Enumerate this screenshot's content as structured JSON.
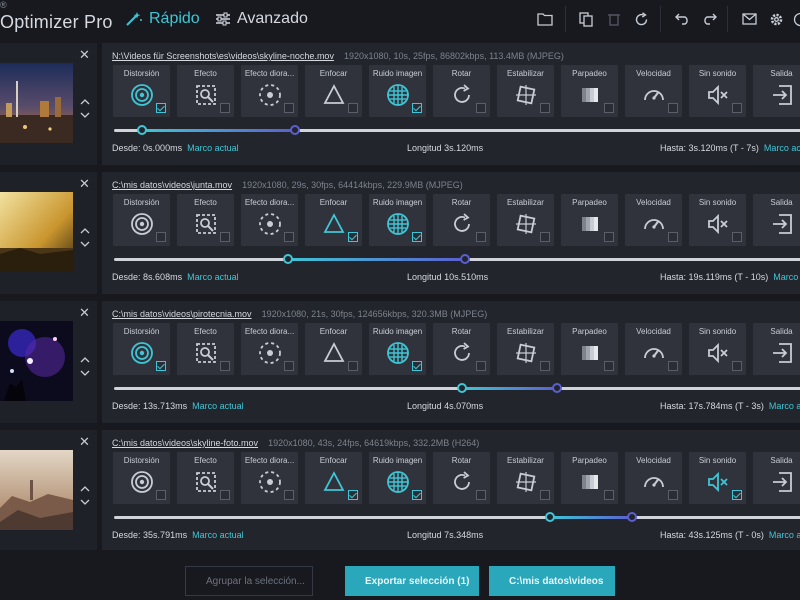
{
  "app": {
    "logo_sup": "®",
    "name": "Optimizer Pro"
  },
  "modes": {
    "quick": "Rápido",
    "advanced": "Avanzado"
  },
  "colors": {
    "accent": "#3fc6d6",
    "accent_purple": "#5b5fcf",
    "panel": "#22252c",
    "tile": "#30333b"
  },
  "tile_labels": [
    "Distorsión",
    "Efecto",
    "Efecto diora...",
    "Enfocar",
    "Ruido imagen",
    "Rotar",
    "Estabilizar",
    "Parpadeo",
    "Velocidad",
    "Sin sonido",
    "Salida"
  ],
  "labels": {
    "from": "Desde:",
    "length": "Longitud",
    "to": "Hasta:",
    "current_frame": "Marco actual"
  },
  "rows": [
    {
      "path": "N:\\Videos für Screenshots\\es\\videos\\skyline-noche.mov",
      "meta": "1920x1080, 10s, 25fps, 86802kbps, 113.4MB (MJPEG)",
      "checked": [
        true,
        false,
        false,
        false,
        true,
        false,
        false,
        false,
        false,
        false,
        false
      ],
      "from": "0s.000ms",
      "length": "3s.120ms",
      "to": "3s.120ms (T - 7s)",
      "range": [
        0.0,
        0.312
      ]
    },
    {
      "path": "C:\\mis datos\\videos\\junta.mov",
      "meta": "1920x1080, 29s, 30fps, 64414kbps, 229.9MB (MJPEG)",
      "checked": [
        false,
        false,
        false,
        true,
        true,
        false,
        false,
        false,
        false,
        false,
        false
      ],
      "from": "8s.608ms",
      "length": "10s.510ms",
      "to": "19s.119ms (T - 10s)",
      "range": [
        0.297,
        0.659
      ]
    },
    {
      "path": "C:\\mis datos\\videos\\pirotecnia.mov",
      "meta": "1920x1080, 21s, 30fps, 124656kbps, 320.3MB (MJPEG)",
      "checked": [
        true,
        false,
        false,
        false,
        true,
        false,
        false,
        false,
        false,
        false,
        false
      ],
      "from": "13s.713ms",
      "length": "4s.070ms",
      "to": "17s.784ms (T - 3s)",
      "range": [
        0.653,
        0.847
      ]
    },
    {
      "path": "C:\\mis datos\\videos\\skyline-foto.mov",
      "meta": "1920x1080, 43s, 24fps, 64619kbps, 332.2MB (H264)",
      "checked": [
        false,
        false,
        false,
        true,
        true,
        false,
        false,
        false,
        false,
        true,
        false
      ],
      "from": "35s.791ms",
      "length": "7s.348ms",
      "to": "43s.125ms (T - 0s)",
      "range": [
        0.832,
        1.0
      ]
    }
  ],
  "footer": {
    "group": "Agrupar la selección...",
    "export": "Exportar selección (1)",
    "save_path": "C:\\mis datos\\videos"
  }
}
